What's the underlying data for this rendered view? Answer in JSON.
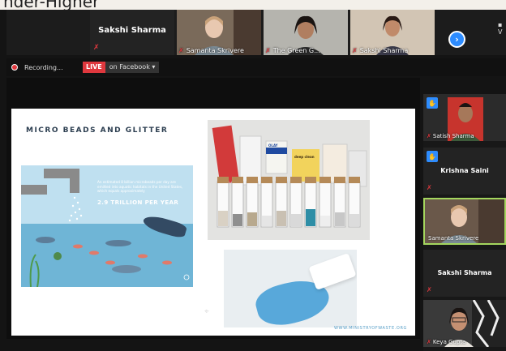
{
  "caption": "nder-Higher",
  "top_participants": [
    {
      "name": "Sakshi Sharma",
      "video": false
    },
    {
      "name": "Samanta Skrivere",
      "video": true
    },
    {
      "name": "The Green G...",
      "video": true
    },
    {
      "name": "Sakshi Sharma",
      "video": true
    }
  ],
  "top_strip_arrow": "›",
  "view_label": "V",
  "recording": {
    "label": "Recording..."
  },
  "live": {
    "tag": "LIVE",
    "platform": "on Facebook ▾"
  },
  "slide": {
    "title": "MICRO BEADS AND GLITTER",
    "infographic_text": "An estimated 8 billion microbeads per day are emitted into aquatic habitats in the United States, which equals approximately",
    "infographic_number": "2.9 TRILLION PER YEAR",
    "url": "WWW.MINISTRYOFWASTE.ORG",
    "product_labels": {
      "olay": "OLAY",
      "deep": "deep clean"
    }
  },
  "side_participants": [
    {
      "name": "Satish Sharma",
      "video": true
    },
    {
      "name": "Krishna Saini",
      "video": false
    },
    {
      "name": "Samanta Skrivere",
      "video": true,
      "active": true
    },
    {
      "name": "Sakshi Sharma",
      "video": false
    },
    {
      "name": "Keya Gupta",
      "video": true
    }
  ],
  "icons": {
    "mic_muted": "mic-muted-icon",
    "pin": "pin-icon",
    "record": "record-dot-icon",
    "cursor": "cursor-icon"
  },
  "colors": {
    "accent": "#2d8cff",
    "live": "#e0383e",
    "active_border": "#a4d65e"
  }
}
